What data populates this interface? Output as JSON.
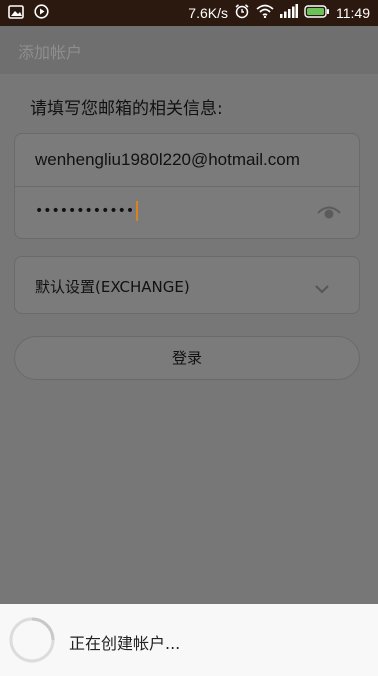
{
  "status_bar": {
    "speed": "7.6K/s",
    "time": "11:49",
    "icons": [
      "image-icon",
      "play-icon",
      "alarm-icon",
      "wifi-icon",
      "signal-icon",
      "battery-icon"
    ]
  },
  "header": {
    "title": "添加帐户"
  },
  "form": {
    "prompt": "请填写您邮箱的相关信息:",
    "email_value": "wenhengliu1980l220@hotmail.com",
    "password_masked": "••••••••••••",
    "server_value": "默认设置(EXCHANGE)",
    "login_label": "登录"
  },
  "dialog": {
    "text": "正在创建帐户..."
  },
  "colors": {
    "accent_cursor": "#d9821f",
    "battery_green": "#6ac259"
  }
}
